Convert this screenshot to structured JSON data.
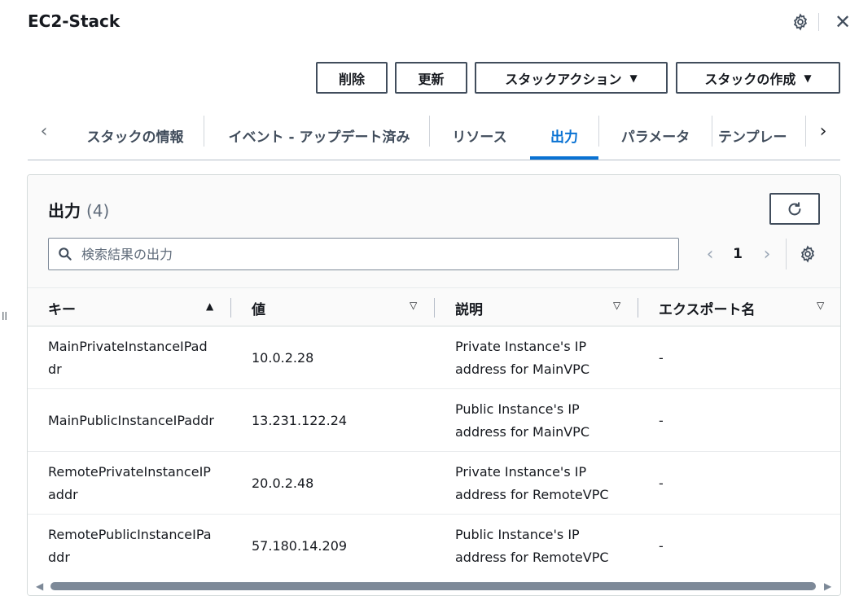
{
  "header": {
    "title": "EC2-Stack",
    "settings_icon": "gear-icon",
    "close_icon": "close-icon",
    "close_glyph": "✕"
  },
  "actions": {
    "delete_label": "削除",
    "update_label": "更新",
    "stack_actions_label": "スタックアクション",
    "create_stack_label": "スタックの作成",
    "dropdown_glyph": "▼"
  },
  "tabs": {
    "prev_glyph": "‹",
    "next_glyph": "›",
    "items": [
      {
        "label": "スタックの情報"
      },
      {
        "label": "イベント - アップデート済み"
      },
      {
        "label": "リソース"
      },
      {
        "label": "出力",
        "active": true
      },
      {
        "label": "パラメータ"
      },
      {
        "label": "テンプレー"
      }
    ]
  },
  "outputs": {
    "title": "出力",
    "count": "(4)",
    "search_placeholder": "検索結果の出力",
    "page_prev": "‹",
    "page": "1",
    "page_next": "›",
    "columns": [
      {
        "label": "キー",
        "sort": "▲"
      },
      {
        "label": "値",
        "sort": "▽"
      },
      {
        "label": "説明",
        "sort": "▽"
      },
      {
        "label": "エクスポート名",
        "sort": "▽"
      }
    ],
    "rows": [
      {
        "key": "MainPrivateInstanceIPaddr",
        "value": "10.0.2.28",
        "desc1": "Private Instance's IP",
        "desc2": "address for MainVPC",
        "export": "-"
      },
      {
        "key": "MainPublicInstanceIPaddr",
        "value": "13.231.122.24",
        "desc1": "Public Instance's IP",
        "desc2": "address for MainVPC",
        "export": "-"
      },
      {
        "key": "RemotePrivateInstanceIPaddr",
        "value": "20.0.2.48",
        "desc1": "Private Instance's IP",
        "desc2": "address for RemoteVPC",
        "export": "-"
      },
      {
        "key": "RemotePublicInstanceIPaddr",
        "value": "57.180.14.209",
        "desc1": "Public Instance's IP",
        "desc2": "address for RemoteVPC",
        "export": "-"
      }
    ]
  },
  "scrollbar": {
    "left_glyph": "◀",
    "right_glyph": "▶"
  },
  "resize_glyph": "॥"
}
